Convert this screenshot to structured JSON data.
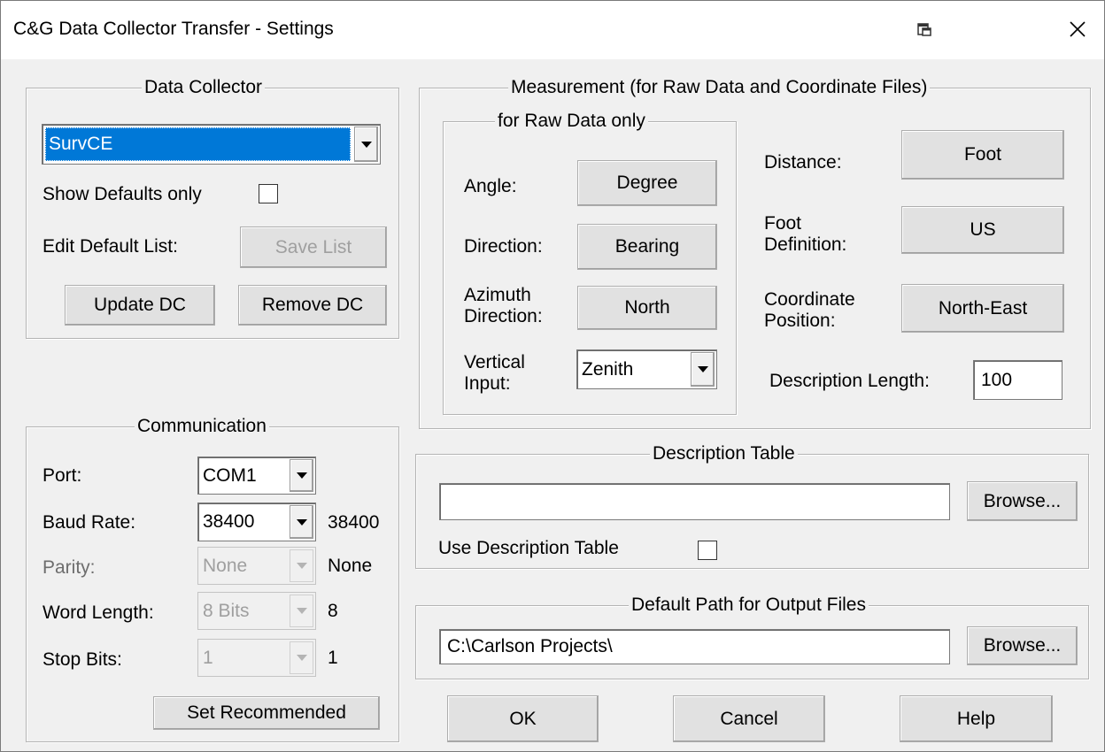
{
  "window": {
    "title": "C&G Data Collector Transfer - Settings",
    "icons": [
      "restore-window-icon",
      "close-icon"
    ]
  },
  "data_collector": {
    "legend": "Data Collector",
    "selected": "SurvCE",
    "show_defaults_label": "Show Defaults only",
    "show_defaults_checked": false,
    "edit_default_label": "Edit Default List:",
    "save_list": "Save List",
    "update_dc": "Update DC",
    "remove_dc": "Remove DC"
  },
  "measurement": {
    "legend": "Measurement (for Raw Data and Coordinate Files)",
    "raw_legend": "for Raw Data only",
    "angle_label": "Angle:",
    "angle_value": "Degree",
    "direction_label": "Direction:",
    "direction_value": "Bearing",
    "azimuth_label_1": "Azimuth",
    "azimuth_label_2": "Direction:",
    "azimuth_value": "North",
    "vertical_label_1": "Vertical",
    "vertical_label_2": "Input:",
    "vertical_value": "Zenith",
    "distance_label": "Distance:",
    "distance_value": "Foot",
    "foot_def_label_1": "Foot",
    "foot_def_label_2": "Definition:",
    "foot_def_value": "US",
    "coord_pos_label_1": "Coordinate",
    "coord_pos_label_2": "Position:",
    "coord_pos_value": "North-East",
    "desc_length_label": "Description Length:",
    "desc_length_value": "100"
  },
  "communication": {
    "legend": "Communication",
    "port_label": "Port:",
    "port_value": "COM1",
    "baud_label": "Baud Rate:",
    "baud_value": "38400",
    "baud_display": "38400",
    "parity_label": "Parity:",
    "parity_value": "None",
    "parity_display": "None",
    "word_label": "Word Length:",
    "word_value": "8 Bits",
    "word_display": "8",
    "stop_label": "Stop Bits:",
    "stop_value": "1",
    "stop_display": "1",
    "set_recommended": "Set Recommended"
  },
  "description_table": {
    "legend": "Description Table",
    "path_value": "",
    "browse": "Browse...",
    "use_label": "Use Description Table",
    "use_checked": false
  },
  "output_path": {
    "legend": "Default Path for Output Files",
    "path_value": "C:\\Carlson Projects\\",
    "browse": "Browse..."
  },
  "buttons": {
    "ok": "OK",
    "cancel": "Cancel",
    "help": "Help"
  }
}
